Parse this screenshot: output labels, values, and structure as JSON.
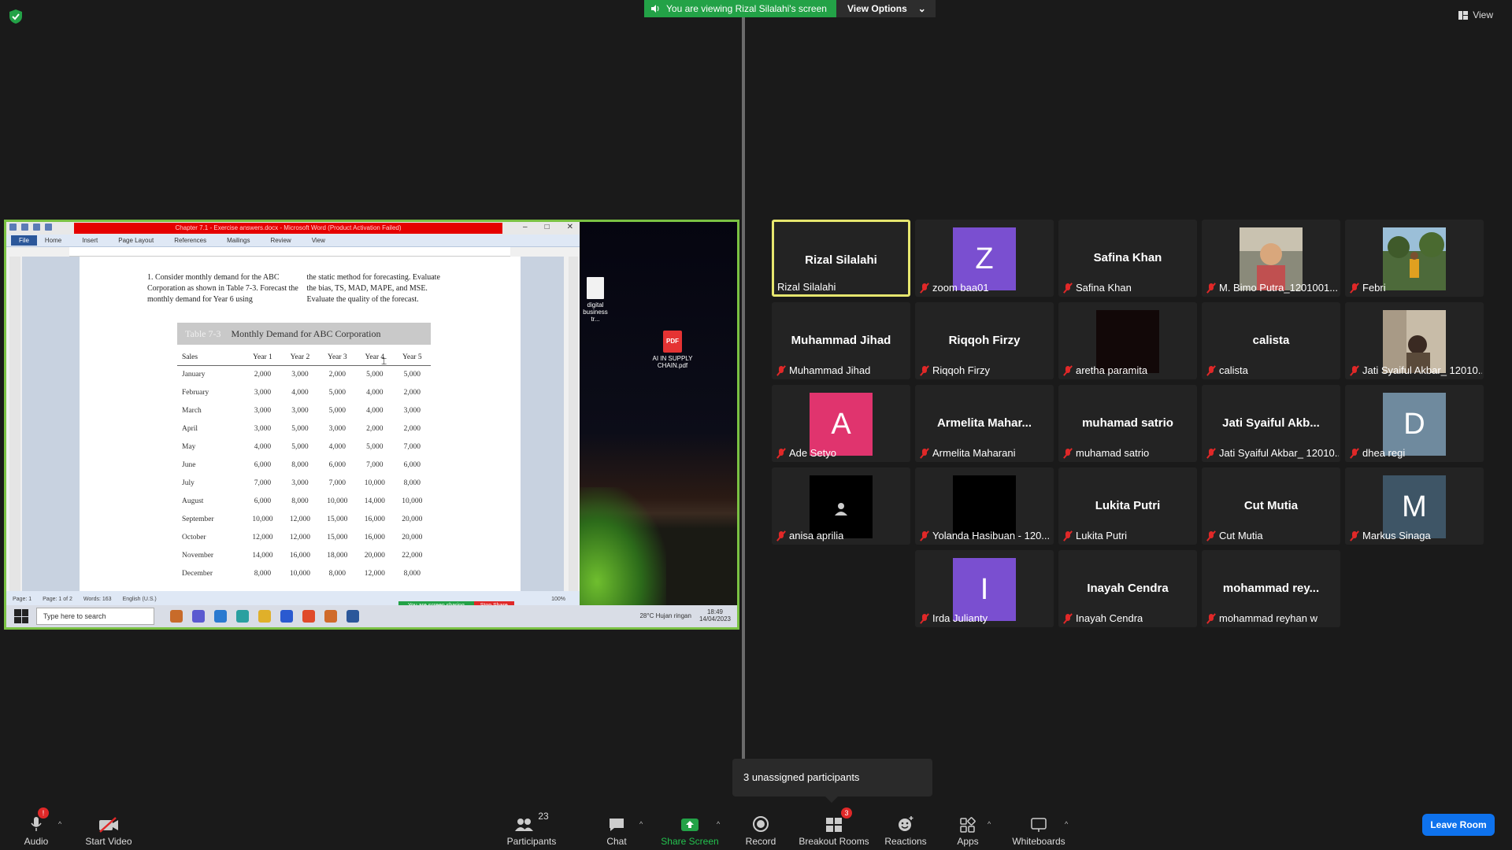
{
  "banner": {
    "viewing_text": "You are viewing Rizal Silalahi's screen",
    "view_options": "View Options"
  },
  "top_right": {
    "view_label": "View"
  },
  "shared": {
    "word_title": "Chapter 7.1 - Exercise answers.docx - Microsoft Word (Product Activation Failed)",
    "ribbon_tabs": [
      "File",
      "Home",
      "Insert",
      "Page Layout",
      "References",
      "Mailings",
      "Review",
      "View"
    ],
    "question_col1": "1. Consider monthly demand for the ABC Corporation as shown in Table 7-3. Forecast the monthly demand for Year 6 using",
    "question_col2": "the static method for forecasting. Evaluate the bias, TS, MAD, MAPE, and MSE. Evaluate the quality of the forecast.",
    "table_number": "Table 7-3",
    "table_caption": "Monthly Demand for ABC Corporation",
    "table_headers": [
      "Sales",
      "Year 1",
      "Year 2",
      "Year 3",
      "Year 4",
      "Year 5"
    ],
    "table_rows": [
      [
        "January",
        "2,000",
        "3,000",
        "2,000",
        "5,000",
        "5,000"
      ],
      [
        "February",
        "3,000",
        "4,000",
        "5,000",
        "4,000",
        "2,000"
      ],
      [
        "March",
        "3,000",
        "3,000",
        "5,000",
        "4,000",
        "3,000"
      ],
      [
        "April",
        "3,000",
        "5,000",
        "3,000",
        "2,000",
        "2,000"
      ],
      [
        "May",
        "4,000",
        "5,000",
        "4,000",
        "5,000",
        "7,000"
      ],
      [
        "June",
        "6,000",
        "8,000",
        "6,000",
        "7,000",
        "6,000"
      ],
      [
        "July",
        "7,000",
        "3,000",
        "7,000",
        "10,000",
        "8,000"
      ],
      [
        "August",
        "6,000",
        "8,000",
        "10,000",
        "14,000",
        "10,000"
      ],
      [
        "September",
        "10,000",
        "12,000",
        "15,000",
        "16,000",
        "20,000"
      ],
      [
        "October",
        "12,000",
        "12,000",
        "15,000",
        "16,000",
        "20,000"
      ],
      [
        "November",
        "14,000",
        "16,000",
        "18,000",
        "20,000",
        "22,000"
      ],
      [
        "December",
        "8,000",
        "10,000",
        "8,000",
        "12,000",
        "8,000"
      ]
    ],
    "status_page": "Page: 1",
    "status_pages": "Page: 1 of 2",
    "status_words": "Words: 163",
    "status_lang": "English (U.S.)",
    "status_zoom": "100%",
    "sharing_text": "You are screen sharing",
    "stop_share": "Stop Share",
    "desktop_file1": "digital business tr...",
    "desktop_file2": "AI IN SUPPLY CHAIN.pdf",
    "pdf_badge": "PDF",
    "taskbar_search": "Type here to search",
    "weather": "28°C  Hujan ringan",
    "clock_time": "18:49",
    "clock_date": "14/04/2023"
  },
  "participants": [
    {
      "big": "Rizal Silalahi",
      "label": "Rizal Silalahi",
      "active": true,
      "muted": false
    },
    {
      "avatar": "Z",
      "avatar_color": "#7a4fd0",
      "label": "zoom baa01",
      "muted": true
    },
    {
      "big": "Safina Khan",
      "label": "Safina Khan",
      "muted": true
    },
    {
      "photo": "person-photo",
      "label": "M. Bimo Putra_1201001...",
      "muted": true
    },
    {
      "photo": "outdoor-photo",
      "label": "Febri",
      "muted": true
    },
    {
      "big": "Muhammad Jihad",
      "label": "Muhammad Jihad",
      "muted": true
    },
    {
      "big": "Riqqoh Firzy",
      "label": "Riqqoh Firzy",
      "muted": true
    },
    {
      "dark_video": "#120808",
      "label": "aretha paramita",
      "muted": true
    },
    {
      "big": "calista",
      "label": "calista",
      "muted": true
    },
    {
      "photo": "room-photo",
      "label": "Jati Syaiful Akbar_ 12010...",
      "muted": true
    },
    {
      "avatar": "A",
      "avatar_color": "#e0346e",
      "label": "Ade Setyo",
      "muted": true
    },
    {
      "big": "Armelita  Mahar...",
      "label": "Armelita Maharani",
      "muted": true
    },
    {
      "big": "muhamad satrio",
      "label": "muhamad satrio",
      "muted": true
    },
    {
      "big": "Jati  Syaiful  Akb...",
      "label": "Jati Syaiful Akbar_ 12010...",
      "muted": true
    },
    {
      "avatar": "D",
      "avatar_color": "#6f8a9e",
      "label": "dhea regi",
      "muted": true
    },
    {
      "person_icon": true,
      "label": "anisa aprilia",
      "muted": true
    },
    {
      "dark_video": "#000000",
      "label": "Yolanda Hasibuan - 120...",
      "muted": true
    },
    {
      "big": "Lukita Putri",
      "label": "Lukita Putri",
      "muted": true
    },
    {
      "big": "Cut Mutia",
      "label": "Cut Mutia",
      "muted": true
    },
    {
      "avatar": "M",
      "avatar_color": "#3e5566",
      "label": "Markus Sinaga",
      "muted": true
    },
    {
      "avatar": "I",
      "avatar_color": "#7a4fd0",
      "label": "Irda Julianty",
      "muted": true
    },
    {
      "big": "Inayah Cendra",
      "label": "Inayah Cendra",
      "muted": true
    },
    {
      "big": "mohammad  rey...",
      "label": "mohammad reyhan w",
      "muted": true
    }
  ],
  "popup": {
    "text": "3 unassigned participants"
  },
  "toolbar": {
    "audio": "Audio",
    "audio_badge": "!",
    "start_video": "Start Video",
    "participants": "Participants",
    "participants_count": "23",
    "chat": "Chat",
    "share_screen": "Share Screen",
    "record": "Record",
    "breakout_rooms": "Breakout Rooms",
    "breakout_badge": "3",
    "reactions": "Reactions",
    "apps": "Apps",
    "whiteboards": "Whiteboards",
    "leave_room": "Leave Room"
  }
}
